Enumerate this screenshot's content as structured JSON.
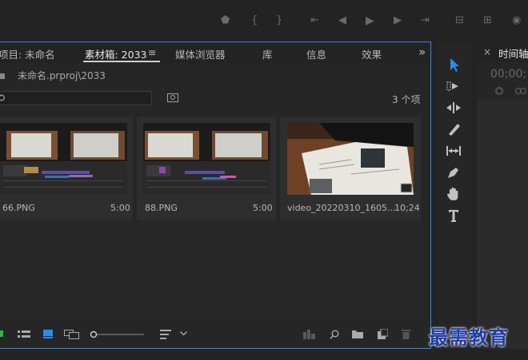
{
  "program_monitor": {
    "controls": [
      {
        "name": "marker-icon",
        "glyph": "⬟"
      },
      {
        "name": "in-point-icon",
        "glyph": "{"
      },
      {
        "name": "out-point-icon",
        "glyph": "}"
      },
      {
        "name": "go-to-in-icon",
        "glyph": "⇤"
      },
      {
        "name": "step-back-icon",
        "glyph": "◀"
      },
      {
        "name": "play-icon",
        "glyph": "▶"
      },
      {
        "name": "step-forward-icon",
        "glyph": "▶"
      },
      {
        "name": "go-to-out-icon",
        "glyph": "⇥"
      },
      {
        "name": "lift-icon",
        "glyph": "⊟"
      },
      {
        "name": "extract-icon",
        "glyph": "⊞"
      },
      {
        "name": "export-frame-icon",
        "glyph": "◉"
      }
    ]
  },
  "project_panel": {
    "tabs": [
      {
        "label": "项目: 未命名",
        "active": false
      },
      {
        "label": "素材箱: 2033",
        "active": true
      },
      {
        "label": "≡",
        "active": false
      },
      {
        "label": "媒体浏览器",
        "active": false
      },
      {
        "label": "库",
        "active": false
      },
      {
        "label": "信息",
        "active": false
      },
      {
        "label": "效果",
        "active": false
      },
      {
        "label": "»",
        "active": false
      }
    ],
    "path": "未命名.prproj\\2033",
    "item_count": "3 个项",
    "items": [
      {
        "name": "66.PNG",
        "duration": "5:00"
      },
      {
        "name": "88.PNG",
        "duration": "5:00"
      },
      {
        "name": "video_20220310_1605...",
        "duration": "10;24"
      }
    ]
  },
  "timeline": {
    "tab_label": "时间轴",
    "close_glyph": "×",
    "timecode": "00;00;"
  },
  "watermark": "最需教育",
  "colors": {
    "accent": "#2d8ceb",
    "panel_bg": "#262626",
    "app_bg": "#232323"
  }
}
